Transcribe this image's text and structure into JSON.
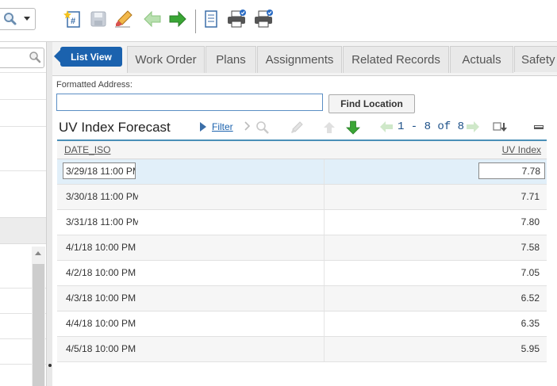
{
  "address": {
    "label": "Formatted Address:",
    "value": "",
    "find_button": "Find Location"
  },
  "tabs": [
    {
      "label": "List View"
    },
    {
      "label": "Work Order"
    },
    {
      "label": "Plans"
    },
    {
      "label": "Assignments"
    },
    {
      "label": "Related Records"
    },
    {
      "label": "Actuals"
    },
    {
      "label": "Safety"
    }
  ],
  "section": {
    "title": "UV Index Forecast",
    "filter_label": "Filter",
    "paging": "1 - 8 of 8"
  },
  "table": {
    "columns": [
      "DATE_ISO",
      "UV Index"
    ],
    "rows": [
      {
        "date": "3/29/18 11:00 PM",
        "uv": "7.78"
      },
      {
        "date": "3/30/18 11:00 PM",
        "uv": "7.71"
      },
      {
        "date": "3/31/18 11:00 PM",
        "uv": "7.80"
      },
      {
        "date": "4/1/18 10:00 PM",
        "uv": "7.58"
      },
      {
        "date": "4/2/18 10:00 PM",
        "uv": "7.05"
      },
      {
        "date": "4/3/18 10:00 PM",
        "uv": "6.52"
      },
      {
        "date": "4/4/18 10:00 PM",
        "uv": "6.35"
      },
      {
        "date": "4/5/18 10:00 PM",
        "uv": "5.95"
      }
    ]
  },
  "colors": {
    "accent": "#1b62ae",
    "selected_row": "#e1eff9",
    "table_border": "#4a8fb8",
    "nav_green": "#3aa635"
  },
  "icons": [
    "search-icon",
    "new-record-icon",
    "save-icon",
    "clear-changes-icon",
    "previous-record-icon",
    "next-record-icon",
    "view-history-icon",
    "print-icon",
    "print-attachments-icon"
  ]
}
